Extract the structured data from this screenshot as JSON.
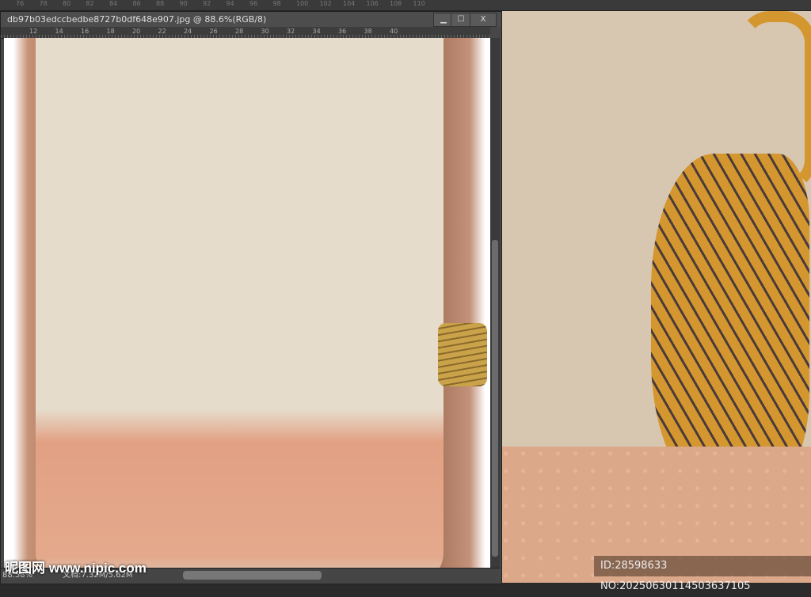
{
  "app": {
    "top_ruler_labels": [
      "76",
      "78",
      "80",
      "82",
      "84",
      "86",
      "88",
      "90",
      "92",
      "94",
      "96",
      "98",
      "100",
      "102",
      "104",
      "106",
      "108",
      "110"
    ]
  },
  "document_window": {
    "title": "db97b03edccbedbe8727b0df648e907.jpg @ 88.6%(RGB/8)",
    "buttons": {
      "minimize": "▁",
      "maximize": "☐",
      "close": "X"
    },
    "ruler_labels": [
      "12",
      "14",
      "16",
      "18",
      "20",
      "22",
      "24",
      "26",
      "28",
      "30",
      "32",
      "34",
      "36",
      "38",
      "40"
    ],
    "status": {
      "zoom": "88.58%",
      "doc_size": "文档:7.32M/5.62M"
    }
  },
  "watermarks": {
    "site": "昵图网 www.nipic.com",
    "id_label": "ID:28598633 NO:20250630114503637105"
  },
  "colors": {
    "panel": "#474747",
    "artwork_bg": "#d8c7b0",
    "tiger": "#d4962f",
    "ground": "#dca88a"
  }
}
